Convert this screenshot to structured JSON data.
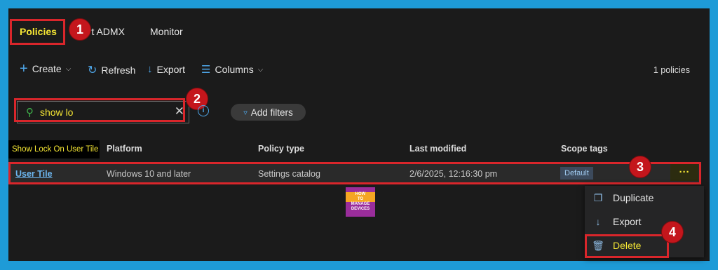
{
  "tabs": [
    {
      "label": "Policies",
      "active": true
    },
    {
      "label": "ort ADMX",
      "active": false
    },
    {
      "label": "Monitor",
      "active": false
    }
  ],
  "toolbar": {
    "create": "Create",
    "refresh": "Refresh",
    "export": "Export",
    "columns": "Columns",
    "count": "1 policies"
  },
  "search": {
    "value": "show lo"
  },
  "add_filters": "Add filters",
  "tooltip": "Show Lock On User Tile",
  "table": {
    "headers": [
      "Platform",
      "Policy type",
      "Last modified",
      "Scope tags"
    ],
    "row": {
      "name": "User Tile",
      "platform": "Windows 10 and later",
      "policy_type": "Settings catalog",
      "last_modified": "2/6/2025, 12:16:30 pm",
      "scope_tag": "Default",
      "more": "···"
    }
  },
  "context_menu": [
    {
      "label": "Duplicate",
      "icon": "duplicate-icon"
    },
    {
      "label": "Export",
      "icon": "download-icon"
    },
    {
      "label": "Delete",
      "icon": "trash-icon"
    }
  ],
  "callouts": [
    "1",
    "2",
    "3",
    "4"
  ],
  "watermark": {
    "lines": [
      "HOW",
      "TO",
      "MANAGE",
      "DEVICES"
    ]
  },
  "colors": {
    "highlight": "#f5e634",
    "annotation": "#d9262b",
    "accent": "#4ea6e8"
  }
}
